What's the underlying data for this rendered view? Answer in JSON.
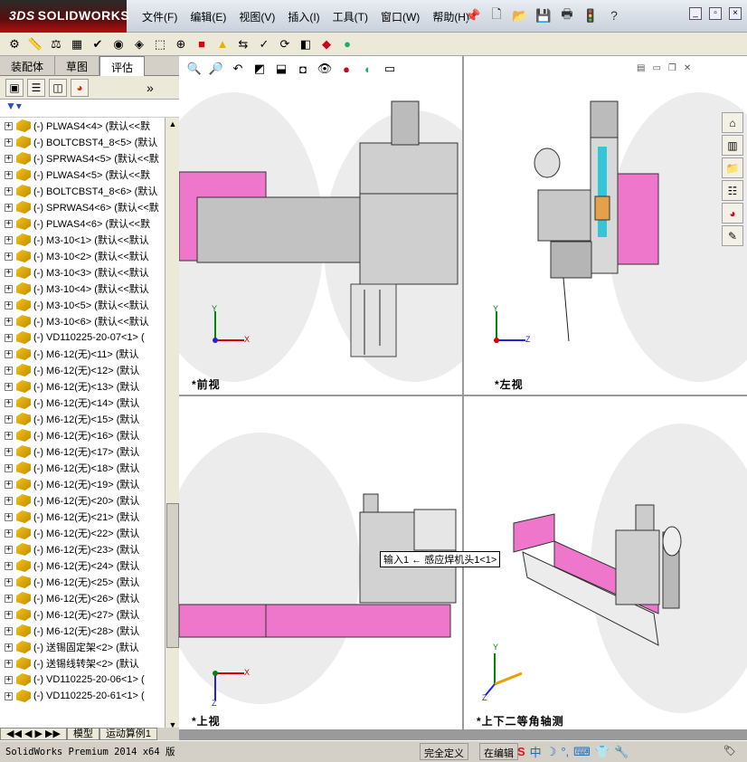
{
  "app": {
    "brand": "SOLIDWORKS",
    "brand_prefix": "3DS"
  },
  "menu": [
    "文件(F)",
    "编辑(E)",
    "视图(V)",
    "插入(I)",
    "工具(T)",
    "窗口(W)",
    "帮助(H)"
  ],
  "left_panel": {
    "tabs": [
      "装配体",
      "草图",
      "评估"
    ],
    "active_tab": "评估",
    "items": [
      "(-) PLWAS4<4> (默认<<默",
      "(-) BOLTCBST4_8<5> (默认",
      "(-) SPRWAS4<5> (默认<<默",
      "(-) PLWAS4<5> (默认<<默",
      "(-) BOLTCBST4_8<6> (默认",
      "(-) SPRWAS4<6> (默认<<默",
      "(-) PLWAS4<6> (默认<<默",
      "(-) M3-10<1> (默认<<默认",
      "(-) M3-10<2> (默认<<默认",
      "(-) M3-10<3> (默认<<默认",
      "(-) M3-10<4> (默认<<默认",
      "(-) M3-10<5> (默认<<默认",
      "(-) M3-10<6> (默认<<默认",
      "(-) VD110225-20-07<1> (",
      "(-) M6-12(无)<11> (默认",
      "(-) M6-12(无)<12> (默认",
      "(-) M6-12(无)<13> (默认",
      "(-) M6-12(无)<14> (默认",
      "(-) M6-12(无)<15> (默认",
      "(-) M6-12(无)<16> (默认",
      "(-) M6-12(无)<17> (默认",
      "(-) M6-12(无)<18> (默认",
      "(-) M6-12(无)<19> (默认",
      "(-) M6-12(无)<20> (默认",
      "(-) M6-12(无)<21> (默认",
      "(-) M6-12(无)<22> (默认",
      "(-) M6-12(无)<23> (默认",
      "(-) M6-12(无)<24> (默认",
      "(-) M6-12(无)<25> (默认",
      "(-) M6-12(无)<26> (默认",
      "(-) M6-12(无)<27> (默认",
      "(-) M6-12(无)<28> (默认",
      "(-) 送锡固定架<2> (默认",
      "(-) 送锡线转架<2> (默认",
      "(-) VD110225-20-06<1> (",
      "(-) VD110225-20-61<1> ("
    ],
    "bottom_tabs": [
      "模型",
      "运动算例1"
    ]
  },
  "viewports": {
    "front": "*前视",
    "left": "*左视",
    "top": "*上视",
    "iso": "*上下二等角轴测"
  },
  "axis_labels": {
    "x": "X",
    "y": "Y",
    "z": "Z"
  },
  "tooltip": "输入1 ← 感应焊机头1<1>",
  "status": {
    "version": "SolidWorks Premium 2014 x64 版",
    "definition": "完全定义",
    "mode": "在编辑",
    "ime": "中"
  },
  "colors": {
    "pink": "#ee77cc",
    "steel": "#b8b8b8",
    "cyan": "#33c6d8"
  }
}
